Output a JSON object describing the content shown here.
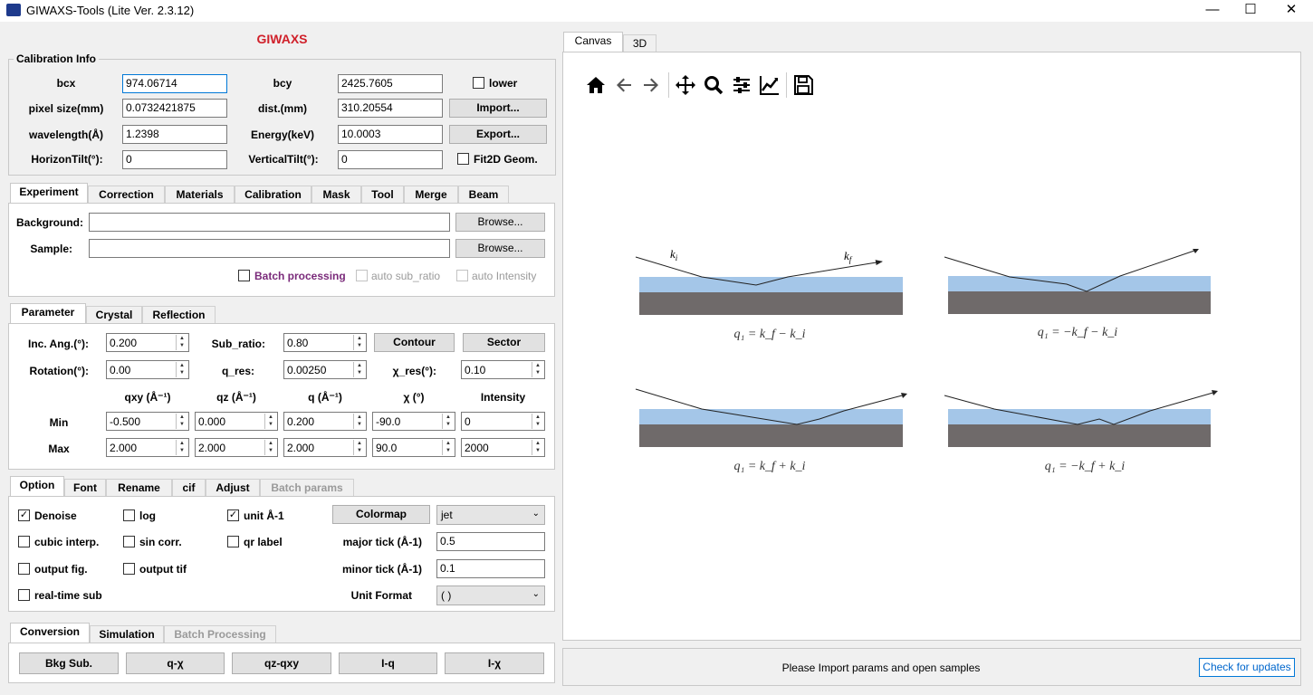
{
  "window": {
    "title": "GIWAXS-Tools (Lite Ver. 2.3.12)",
    "minimize": "—",
    "maximize": "☐",
    "close": "✕"
  },
  "header": "GIWAXS",
  "calibration": {
    "group_label": "Calibration Info",
    "bcx_label": "bcx",
    "bcx_value": "974.06714",
    "bcy_label": "bcy",
    "bcy_value": "2425.7605",
    "lower_label": "lower",
    "pixel_label": "pixel size(mm)",
    "pixel_value": "0.0732421875",
    "dist_label": "dist.(mm)",
    "dist_value": "310.20554",
    "import_label": "Import...",
    "wavelength_label": "wavelength(Å)",
    "wavelength_value": "1.2398",
    "energy_label": "Energy(keV)",
    "energy_value": "10.0003",
    "export_label": "Export...",
    "htilt_label": "HorizonTilt(°):",
    "htilt_value": "0",
    "vtilt_label": "VerticalTilt(°):",
    "vtilt_value": "0",
    "fit2d_label": "Fit2D Geom."
  },
  "tabs1": [
    "Experiment",
    "Correction",
    "Materials",
    "Calibration",
    "Mask",
    "Tool",
    "Merge",
    "Beam"
  ],
  "experiment": {
    "background_label": "Background:",
    "background_value": "",
    "sample_label": "Sample:",
    "sample_value": "",
    "browse_label": "Browse...",
    "batch_label": "Batch processing",
    "auto_sub_label": "auto sub_ratio",
    "auto_int_label": "auto Intensity"
  },
  "tabs2": [
    "Parameter",
    "Crystal",
    "Reflection"
  ],
  "parameter": {
    "inc_label": "Inc. Ang.(°):",
    "inc_value": "0.200",
    "subratio_label": "Sub_ratio:",
    "subratio_value": "0.80",
    "contour_label": "Contour",
    "sector_label": "Sector",
    "rotation_label": "Rotation(°):",
    "rotation_value": "0.00",
    "qres_label": "q_res:",
    "qres_value": "0.00250",
    "xres_label": "χ_res(°):",
    "xres_value": "0.10",
    "columns": [
      "qxy (Å⁻¹)",
      "qz (Å⁻¹)",
      "q (Å⁻¹)",
      "χ (°)",
      "Intensity"
    ],
    "min_label": "Min",
    "max_label": "Max",
    "min_values": [
      "-0.500",
      "0.000",
      "0.200",
      "-90.0",
      "0"
    ],
    "max_values": [
      "2.000",
      "2.000",
      "2.000",
      "90.0",
      "2000"
    ]
  },
  "tabs3": [
    "Option",
    "Font",
    "Rename",
    "cif",
    "Adjust",
    "Batch params"
  ],
  "option": {
    "denoise": "Denoise",
    "log": "log",
    "unit": "unit Å-1",
    "colormap_label": "Colormap",
    "colormap_value": "jet",
    "cubic": "cubic interp.",
    "sin": "sin corr.",
    "qr": "qr label",
    "major_label": "major tick (Å-1)",
    "major_value": "0.5",
    "outfig": "output fig.",
    "outtif": "output tif",
    "minor_label": "minor tick (Å-1)",
    "minor_value": "0.1",
    "realtime": "real-time sub",
    "unitfmt_label": "Unit Format",
    "unitfmt_value": "( )"
  },
  "tabs4": [
    "Conversion",
    "Simulation",
    "Batch Processing"
  ],
  "conversion": [
    "Bkg Sub.",
    "q-χ",
    "qz-qxy",
    "I-q",
    "I-χ"
  ],
  "canvas_tabs": [
    "Canvas",
    "3D"
  ],
  "toolbar_icons": [
    "home-icon",
    "back-icon",
    "forward-icon",
    "pan-icon",
    "zoom-icon",
    "configure-icon",
    "edit-curve-icon",
    "save-icon"
  ],
  "diagrams": {
    "ki": "k",
    "ki_sub": "i",
    "kf": "k",
    "kf_sub": "f",
    "eq1": "q₁ = k_f − k_i",
    "eq2": "q₁ = −k_f − k_i",
    "eq3": "q₁ = k_f + k_i",
    "eq4": "q₁ = −k_f + k_i"
  },
  "status": {
    "message": "Please Import params and open samples",
    "update_label": "Check for updates"
  },
  "colors": {
    "header_red": "#d0202a",
    "film_blue": "#a4c6e8",
    "substrate_gray": "#6f6a6a",
    "batch_purple": "#7a2a7a"
  }
}
